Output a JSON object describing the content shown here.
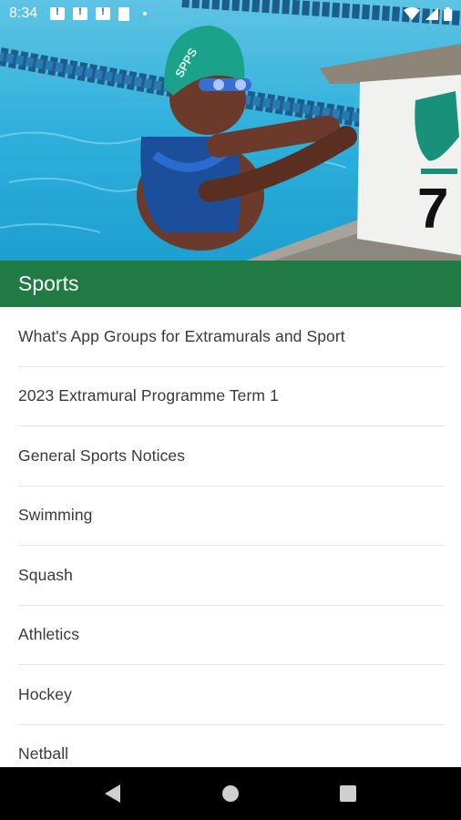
{
  "status_bar": {
    "time": "8:34",
    "icons": [
      "message-alert-icon",
      "message-alert-icon",
      "message-alert-icon",
      "sd-card-icon",
      "dot-icon",
      "wifi-icon",
      "signal-icon",
      "battery-icon"
    ]
  },
  "hero": {
    "image": "swimmer-at-pool-block",
    "block_number": "7",
    "cap_text": "SPPS"
  },
  "section": {
    "title": "Sports",
    "color": "#1f7a44"
  },
  "list": {
    "items": [
      {
        "label": "What's App Groups for Extramurals and Sport"
      },
      {
        "label": "2023 Extramural Programme Term 1"
      },
      {
        "label": "General Sports Notices"
      },
      {
        "label": "Swimming"
      },
      {
        "label": "Squash"
      },
      {
        "label": "Athletics"
      },
      {
        "label": "Hockey"
      },
      {
        "label": "Netball"
      }
    ]
  },
  "nav_bar": {
    "buttons": [
      "back-icon",
      "home-icon",
      "recents-icon"
    ]
  }
}
